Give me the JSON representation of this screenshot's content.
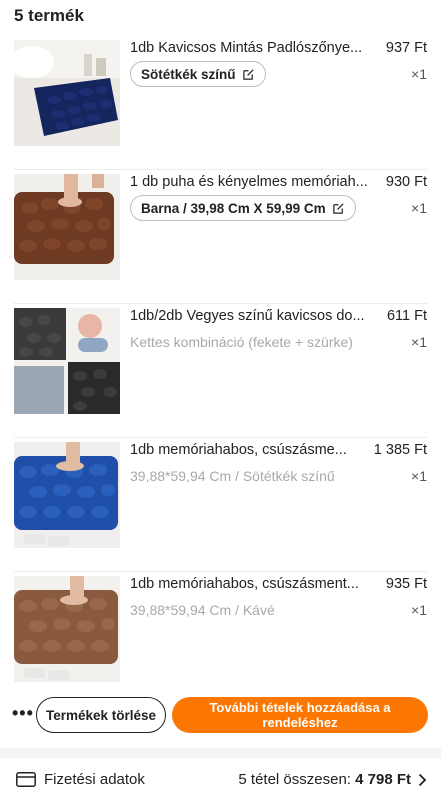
{
  "header": {
    "count_label": "5 termék"
  },
  "items": [
    {
      "title": "1db Kavicsos Mintás Padlószőnye...",
      "price": "937 Ft",
      "variant": "Sötétkék színű",
      "variant_editable": true,
      "qty": "×1",
      "image": "navy-pebble-bath-mat"
    },
    {
      "title": "1 db puha és kényelmes memóriah...",
      "price": "930 Ft",
      "variant": "Barna / 39,98 Cm X 59,99 Cm",
      "variant_editable": true,
      "qty": "×1",
      "image": "brown-pebble-bath-mat"
    },
    {
      "title": "1db/2db Vegyes színű kavicsos do...",
      "price": "611 Ft",
      "variant": "Kettes kombináció (fekete + szürke)",
      "variant_editable": false,
      "qty": "×1",
      "image": "black-gray-pebble-mats-collage"
    },
    {
      "title": "1db memóriahabos, csúszásme...",
      "price": "1 385 Ft",
      "variant": "39,88*59,94 Cm / Sötétkék színű",
      "variant_editable": false,
      "qty": "×1",
      "image": "blue-pebble-bath-mat"
    },
    {
      "title": "1db memóriahabos, csúszásment...",
      "price": "935 Ft",
      "variant": "39,88*59,94 Cm / Kávé",
      "variant_editable": false,
      "qty": "×1",
      "image": "coffee-pebble-bath-mat"
    }
  ],
  "actions": {
    "more_label": "•••",
    "delete_label": "Termékek törlése",
    "add_label": "További tételek hozzáadása a rendeléshez"
  },
  "footer": {
    "payment_label": "Fizetési adatok",
    "total_prefix": "5 tétel összesen: ",
    "total_value": "4 798 Ft"
  },
  "colors": {
    "accent": "#fb7701",
    "muted_text": "#a8a8a8"
  }
}
